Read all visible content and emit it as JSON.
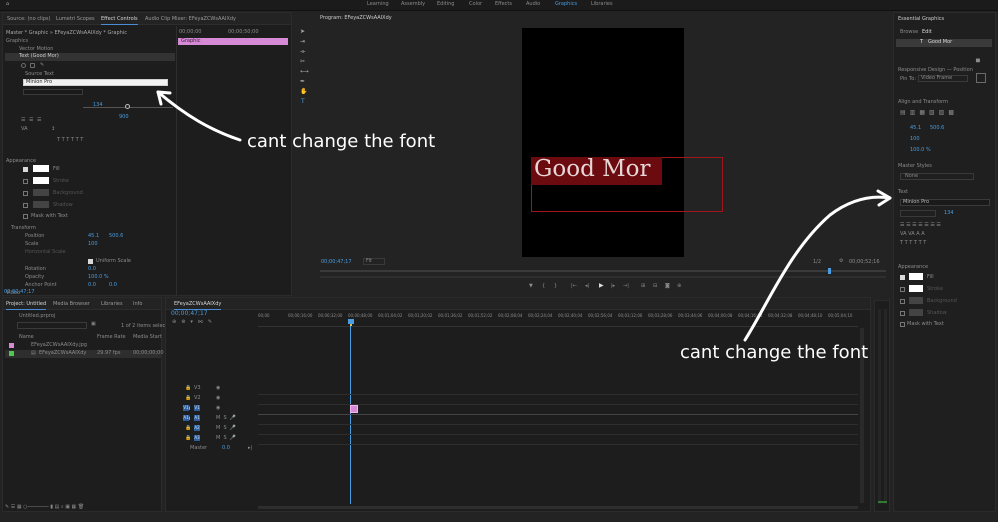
{
  "top_bar": {
    "workspaces": [
      "Learning",
      "Assembly",
      "Editing",
      "Color",
      "Effects",
      "Audio",
      "Graphics",
      "Libraries"
    ],
    "active": "Graphics"
  },
  "effect_controls": {
    "tabs": [
      "Source: (no clips)",
      "Lumetri Scopes",
      "Effect Controls",
      "Audio Clip Mixer: EFeyaZCWsAAIXdy"
    ],
    "header": "Master * Graphic  »  EFeyaZCWsAAIXdy * Graphic",
    "timecode_start": "00;00;00",
    "timecode_mid": "00;00;50;00",
    "clip_label": "Graphic",
    "section": "Graphics",
    "vector_motion": "Vector Motion",
    "text_layer": "Text (Good Mor)",
    "source_text": "Source Text",
    "font_field": "Minion Pro",
    "font_size": "134",
    "tracking": "900",
    "appearance": "Appearance",
    "fill": "Fill",
    "stroke": "Stroke",
    "background": "Background",
    "shadow": "Shadow",
    "mask_with_text": "Mask with Text",
    "transform": "Transform",
    "position_label": "Position",
    "position_x": "45.1",
    "position_y": "500.6",
    "scale_label": "Scale",
    "scale_value": "100",
    "scale_h_label": "Horizontal Scale",
    "uniform_scale": "Uniform Scale",
    "rotation_label": "Rotation",
    "rotation_value": "0.0",
    "opacity_label": "Opacity",
    "opacity_value": "100.0 %",
    "anchor_label": "Anchor Point",
    "anchor_x": "0.0",
    "anchor_y": "0.0",
    "video_label": "Video",
    "timecode": "00;00;47;17"
  },
  "program": {
    "tab": "Program: EFeyaZCWsAAIXdy",
    "canvas_text": "Good Mor",
    "timecode_left": "00;00;47;17",
    "fit": "Fit",
    "fraction": "1/2",
    "timecode_right": "00;00;52;16"
  },
  "essential_graphics": {
    "title": "Essential Graphics",
    "tabs": [
      "Browse",
      "Edit"
    ],
    "layer_name": "Good Mor",
    "responsive": "Responsive Design — Position",
    "pin_to": "Pin To:",
    "pin_value": "Video Frame",
    "align_title": "Align and Transform",
    "pos_x": "45.1",
    "pos_y": "500.6",
    "scale": "100",
    "opacity": "100.0 %",
    "master_styles": "Master Styles",
    "style_value": "None",
    "text_title": "Text",
    "font_value": "Minion Pro",
    "size_value": "134",
    "appearance": "Appearance",
    "fill": "Fill",
    "stroke": "Stroke",
    "background": "Background",
    "shadow": "Shadow",
    "mask_with_text": "Mask with Text"
  },
  "project": {
    "tabs": [
      "Project: Untitled",
      "Media Browser",
      "Libraries",
      "Info"
    ],
    "file": "Untitled.prproj",
    "items_selected": "1 of 2 items selected",
    "col_name": "Name",
    "col_rate": "Frame Rate",
    "col_start": "Media Start",
    "rows": [
      {
        "name": "EFeyaZCWsAAIXdy.jpg",
        "rate": "",
        "start": ""
      },
      {
        "name": "EFeyaZCWsAAIXdy",
        "rate": "29.97 fps",
        "start": "00;00;00;00"
      }
    ]
  },
  "timeline": {
    "tab": "EFeyaZCWsAAIXdy",
    "timecode": "00;00;47;17",
    "ruler": [
      "00;00",
      "00;00;16;00",
      "00;00;32;00",
      "00;00;48;00",
      "00;01;04;02",
      "00;01;20;02",
      "00;01;36;02",
      "00;01;52;02",
      "00;02;08;04",
      "00;02;24;04",
      "00;02;40;04",
      "00;02;56;04",
      "00;03;12;06",
      "00;03;28;06",
      "00;03;44;06",
      "00;04;00;08",
      "00;04;16;08",
      "00;04;32;08",
      "00;04;48;10",
      "00;05;04;10"
    ],
    "video_tracks": [
      "V3",
      "V2",
      "V1"
    ],
    "audio_tracks": [
      "A1",
      "A2",
      "A3"
    ],
    "master": "Master",
    "master_value": "0.0"
  },
  "annotations": [
    "cant change the font",
    "cant change the font"
  ],
  "colors": {
    "accent": "#4a9de0",
    "clip": "#d68ad6",
    "text_bg": "#6b0a0f"
  }
}
